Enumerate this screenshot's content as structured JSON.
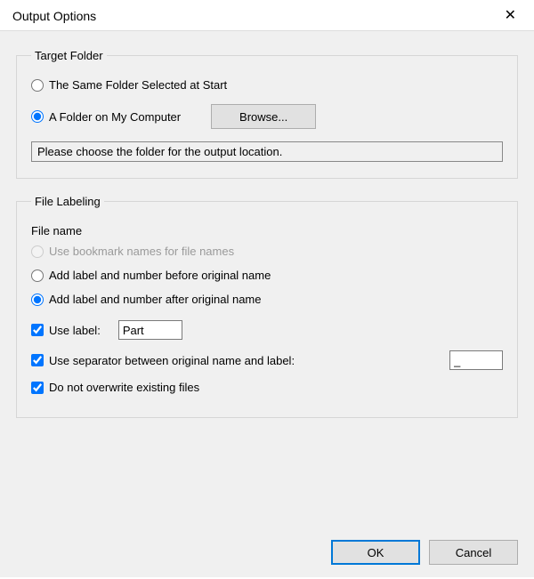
{
  "title": "Output Options",
  "target_folder": {
    "legend": "Target Folder",
    "same_folder_label": "The Same Folder Selected at Start",
    "my_computer_label": "A Folder on My Computer",
    "selected": "my_computer",
    "browse_label": "Browse...",
    "folder_path_display": "Please choose the folder for the output location."
  },
  "file_labeling": {
    "legend": "File Labeling",
    "file_name_heading": "File name",
    "use_bookmark_label": "Use bookmark names for file names",
    "use_bookmark_enabled": false,
    "add_before_label": "Add label and number before original name",
    "add_after_label": "Add label and number after original name",
    "filename_selected": "after",
    "use_label_label": "Use label:",
    "use_label_checked": true,
    "label_value": "Part",
    "use_separator_label": "Use separator between original name and label:",
    "use_separator_checked": true,
    "separator_value": "_",
    "no_overwrite_label": "Do not overwrite existing files",
    "no_overwrite_checked": true
  },
  "buttons": {
    "ok": "OK",
    "cancel": "Cancel"
  }
}
